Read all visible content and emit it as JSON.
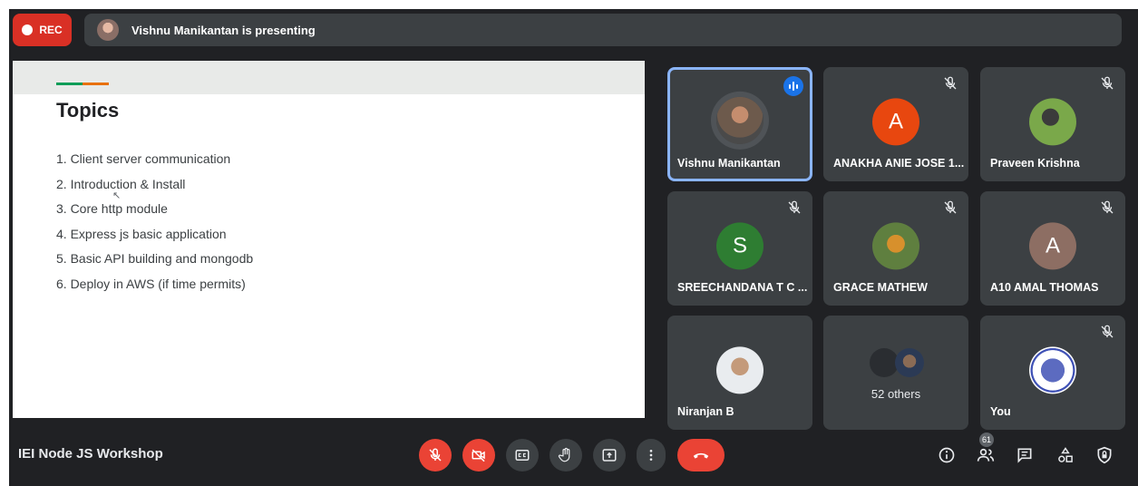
{
  "recording": {
    "label": "REC"
  },
  "presenting_banner": {
    "text": "Vishnu Manikantan is presenting"
  },
  "slide": {
    "title": "Topics",
    "accent_colors": [
      "#0f9d58",
      "#e8710a"
    ],
    "topics": [
      "1. Client server communication",
      "2. Introduction & Install",
      "3. Core http module",
      "4. Express js basic application",
      "5. Basic API building and mongodb",
      "6. Deploy in AWS (if time permits)"
    ]
  },
  "participants": [
    {
      "name": "Vishnu Manikantan",
      "avatar": "photo",
      "status": "speaking"
    },
    {
      "name": "ANAKHA ANIE JOSE 1...",
      "initial": "A",
      "avatar_color": "#e8470f",
      "status": "muted"
    },
    {
      "name": "Praveen Krishna",
      "avatar": "photo",
      "status": "muted"
    },
    {
      "name": "SREECHANDANA T C ...",
      "initial": "S",
      "avatar_color": "#2e7d32",
      "status": "muted"
    },
    {
      "name": "GRACE MATHEW",
      "avatar": "photo",
      "status": "muted"
    },
    {
      "name": "A10 AMAL THOMAS",
      "initial": "A",
      "avatar_color": "#8d6e63",
      "status": "muted"
    },
    {
      "name": "Niranjan B",
      "avatar": "photo",
      "status": "unmuted"
    },
    {
      "others_label": "52 others"
    },
    {
      "name": "You",
      "avatar": "logo",
      "status": "muted"
    }
  ],
  "bottom_bar": {
    "meeting_title": "IEI Node JS Workshop",
    "people_count": "61",
    "controls": [
      "mic-off-icon",
      "camera-off-icon",
      "captions-icon",
      "raise-hand-icon",
      "present-screen-icon",
      "more-options-icon",
      "end-call-icon"
    ],
    "right_icons": [
      "info-icon",
      "people-icon",
      "chat-icon",
      "activities-icon",
      "host-controls-icon"
    ]
  },
  "colors": {
    "background": "#202124",
    "tile": "#3c4043",
    "rec_red": "#d93025",
    "end_call": "#ea4335",
    "speaking_blue": "#1a73e8",
    "active_border": "#8ab4f8"
  }
}
